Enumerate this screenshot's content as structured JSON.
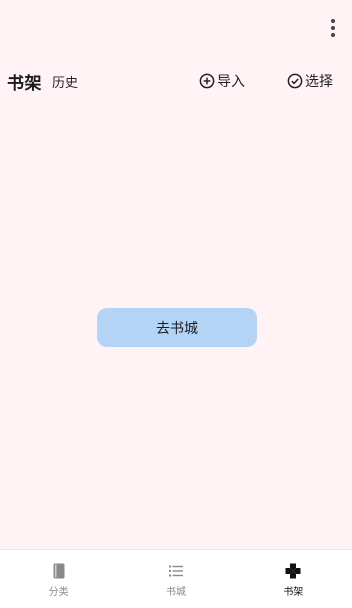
{
  "header": {
    "title": "书架",
    "history_label": "历史",
    "import_label": "导入",
    "select_label": "选择"
  },
  "main": {
    "empty_action_label": "去书城"
  },
  "bottom_nav": {
    "items": [
      {
        "label": "分类",
        "icon": "book-icon",
        "active": false
      },
      {
        "label": "书城",
        "icon": "list-icon",
        "active": false
      },
      {
        "label": "书架",
        "icon": "gamepad-icon",
        "active": true
      }
    ]
  },
  "colors": {
    "background": "#fff3f6",
    "button": "#b3d4f5",
    "nav_background": "#ffffff"
  }
}
